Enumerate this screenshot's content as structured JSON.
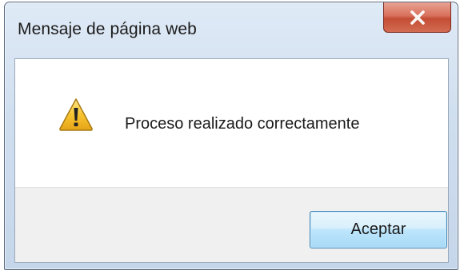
{
  "dialog": {
    "title": "Mensaje de página web",
    "message": "Proceso realizado correctamente",
    "ok_label": "Aceptar",
    "close_glyph": "✕",
    "icon": "warning-icon"
  },
  "colors": {
    "titlebar_top": "#dfeaf6",
    "titlebar_bottom": "#c6d6ea",
    "close_button_red": "#c44d34",
    "button_area": "#f0f0f0",
    "ok_button_border": "#3c7fb1",
    "warning_yellow": "#f7c531"
  }
}
